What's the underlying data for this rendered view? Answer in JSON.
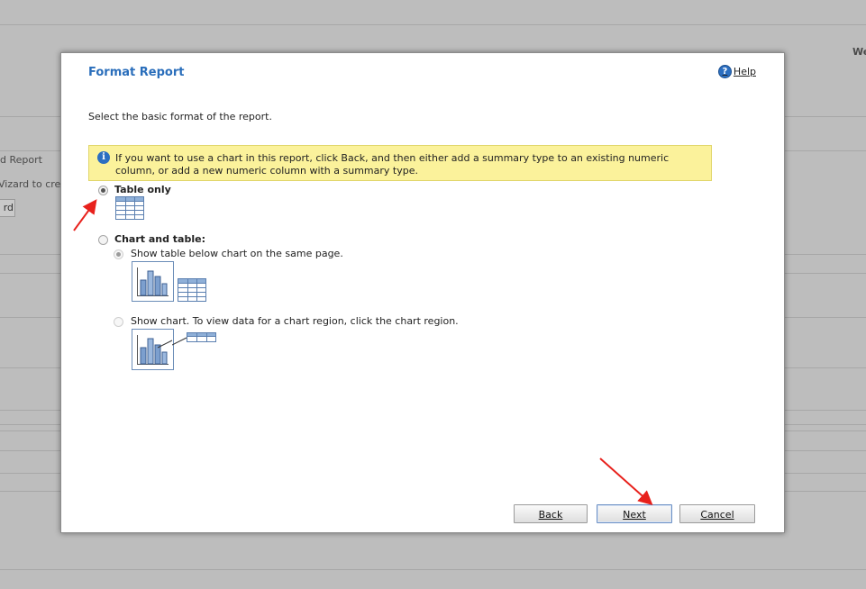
{
  "background": {
    "texts": [
      "We",
      "d Report",
      "Vizard to creat",
      "rd"
    ]
  },
  "dialog": {
    "title": "Format Report",
    "help_label": "Help",
    "subtitle": "Select the basic format of the report.",
    "info_text": "If you want to use a chart in this report, click Back, and then either add a summary type to an existing numeric column, or add a new numeric column with a summary type.",
    "options": {
      "table_only": {
        "label": "Table only",
        "selected": true
      },
      "chart_and_table": {
        "label": "Chart and table:",
        "selected": false,
        "sub_options": [
          {
            "label": "Show table below chart on the same page.",
            "selected": true,
            "enabled": false
          },
          {
            "label": "Show chart. To view data for a chart region, click the chart region.",
            "selected": false,
            "enabled": false
          }
        ]
      }
    },
    "buttons": {
      "back": "Back",
      "next": "Next",
      "cancel": "Cancel"
    }
  },
  "colors": {
    "title": "#2a6ebb",
    "info_bg": "#fbf29b",
    "annotation_arrow": "#e8211c"
  }
}
